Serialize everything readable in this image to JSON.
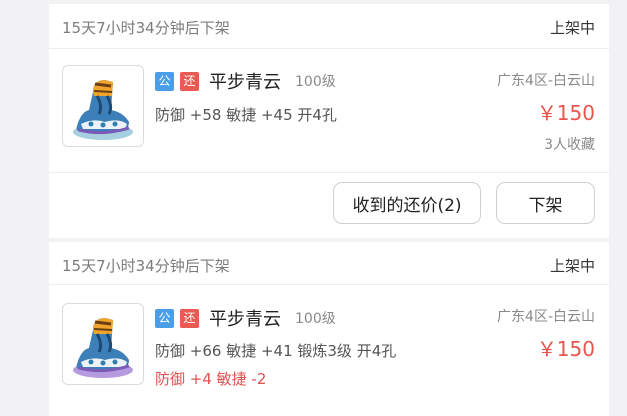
{
  "listings": [
    {
      "timer": "15天7小时34分钟后下架",
      "status": "上架中",
      "badge_public": "公",
      "badge_bargain": "还",
      "name": "平步青云",
      "level": "100级",
      "stats": "防御 +58 敏捷 +45 开4孔",
      "server": "广东4区-白云山",
      "price": "￥150",
      "favorites": "3人收藏",
      "offers_button": "收到的还价(2)",
      "delist_button": "下架"
    },
    {
      "timer": "15天7小时34分钟后下架",
      "status": "上架中",
      "badge_public": "公",
      "badge_bargain": "还",
      "name": "平步青云",
      "level": "100级",
      "stats": "防御 +66 敏捷 +41 锻炼3级 开4孔",
      "stats_extra": "防御 +4 敏捷 -2",
      "server": "广东4区-白云山",
      "price": "￥150"
    }
  ],
  "colors": {
    "price": "#e8554d",
    "badge_public": "#4a9ee8",
    "badge_bargain": "#ea5a52",
    "background": "#f2f2f4"
  },
  "icons": {
    "item_image": "boots-icon"
  }
}
